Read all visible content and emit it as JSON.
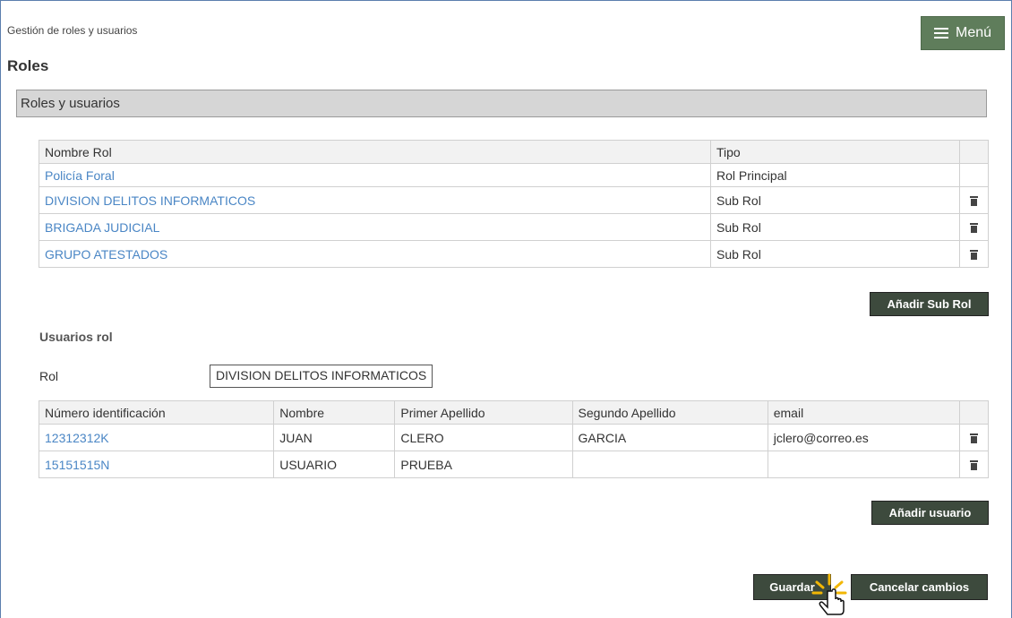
{
  "breadcrumb": "Gestión de roles y usuarios",
  "menu_label": "Menú",
  "page_title": "Roles",
  "section_title": "Roles y usuarios",
  "roles_table": {
    "headers": [
      "Nombre Rol",
      "Tipo"
    ],
    "rows": [
      {
        "name": "Policía Foral",
        "type": "Rol Principal",
        "delete": false
      },
      {
        "name": "DIVISION DELITOS INFORMATICOS",
        "type": "Sub Rol",
        "delete": true
      },
      {
        "name": "BRIGADA JUDICIAL",
        "type": "Sub Rol",
        "delete": true
      },
      {
        "name": "GRUPO ATESTADOS",
        "type": "Sub Rol",
        "delete": true
      }
    ]
  },
  "add_subrole_label": "Añadir Sub Rol",
  "users_title": "Usuarios rol",
  "rol_label": "Rol",
  "rol_value": "DIVISION DELITOS INFORMATICOS",
  "users_table": {
    "headers": [
      "Número identificación",
      "Nombre",
      "Primer Apellido",
      "Segundo Apellido",
      "email"
    ],
    "rows": [
      {
        "id": "12312312K",
        "nombre": "JUAN",
        "apellido1": "CLERO",
        "apellido2": "GARCIA",
        "email": "jclero@correo.es"
      },
      {
        "id": "15151515N",
        "nombre": "USUARIO",
        "apellido1": "PRUEBA",
        "apellido2": "",
        "email": ""
      }
    ]
  },
  "add_user_label": "Añadir usuario",
  "save_label": "Guardar",
  "cancel_label": "Cancelar cambios",
  "colors": {
    "menu_bg": "#5f7d5b",
    "button_dark": "#3d4a3d",
    "link": "#4a86c5"
  }
}
